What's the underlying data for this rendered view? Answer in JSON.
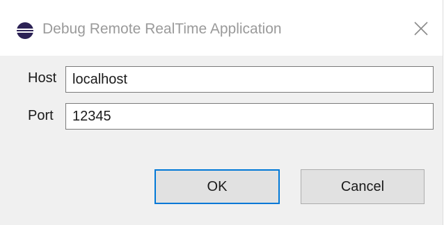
{
  "window": {
    "title": "Debug Remote RealTime Application",
    "app_icon": "eclipse-icon",
    "close_icon": "close-icon"
  },
  "form": {
    "host_label": "Host",
    "host_value": "localhost",
    "port_label": "Port",
    "port_value": "12345"
  },
  "buttons": {
    "ok_label": "OK",
    "cancel_label": "Cancel"
  },
  "colors": {
    "default_button_border": "#0078d7",
    "content_background": "#f0f0f0",
    "title_text": "#9a9a9a"
  }
}
